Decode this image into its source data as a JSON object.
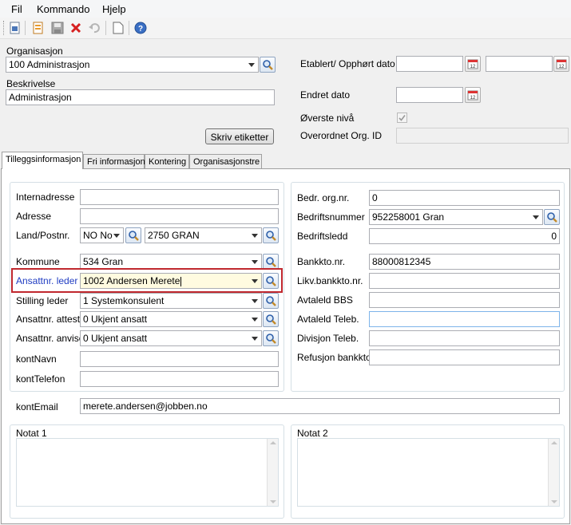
{
  "menu": {
    "file": "Fil",
    "command": "Kommando",
    "help": "Hjelp"
  },
  "header": {
    "organisasjon_label": "Organisasjon",
    "organisasjon_value": "100 Administrasjon",
    "beskrivelse_label": "Beskrivelse",
    "beskrivelse_value": "Administrasjon",
    "etablert_label": "Etablert/ Opphørt dato",
    "endret_label": "Endret dato",
    "overste_label": "Øverste nivå",
    "overste_checked": true,
    "overordnet_label": "Overordnet Org. ID",
    "skriv_etiketter": "Skriv etiketter"
  },
  "tabs": [
    {
      "label": "Tilleggsinformasjon",
      "active": true
    },
    {
      "label": "Fri informasjon",
      "active": false
    },
    {
      "label": "Kontering",
      "active": false
    },
    {
      "label": "Organisasjonstre",
      "active": false
    }
  ],
  "left": {
    "internadresse_label": "Internadresse",
    "internadresse_value": "",
    "adresse_label": "Adresse",
    "adresse_value": "",
    "land_label": "Land/Postnr.",
    "land_value": "NO No",
    "postnr_value": "2750 GRAN",
    "kommune_label": "Kommune",
    "kommune_value": "534 Gran",
    "ansattnr_leder_label": "Ansattnr. leder",
    "ansattnr_leder_value": "1002 Andersen Merete",
    "stilling_label": "Stilling leder",
    "stilling_value": "1 Systemkonsulent",
    "attesta_label": "Ansattnr. attesta",
    "attesta_value": "0 Ukjent ansatt",
    "anvise_label": "Ansattnr. anvise",
    "anvise_value": "0 Ukjent ansatt",
    "kontnavn_label": "kontNavn",
    "kontnavn_value": "",
    "konttelefon_label": "kontTelefon",
    "konttelefon_value": ""
  },
  "right": {
    "bedr_label": "Bedr. org.nr.",
    "bedr_value": "0",
    "bedriftsnummer_label": "Bedriftsnummer",
    "bedriftsnummer_value": "952258001 Gran",
    "bedriftsledd_label": "Bedriftsledd",
    "bedriftsledd_value": "0",
    "bankkto_label": "Bankkto.nr.",
    "bankkto_value": "88000812345",
    "likv_label": "Likv.bankkto.nr.",
    "likv_value": "",
    "avtaleld_bbs_label": "Avtaleld BBS",
    "avtaleld_bbs_value": "",
    "avtaleld_teleb_label": "Avtaleld Teleb.",
    "avtaleld_teleb_value": "",
    "divisjon_label": "Divisjon Teleb.",
    "divisjon_value": "",
    "refusjon_label": "Refusjon bankkto",
    "refusjon_value": ""
  },
  "kontemail_label": "kontEmail",
  "kontemail_value": "merete.andersen@jobben.no",
  "notat1_label": "Notat 1",
  "notat2_label": "Notat 2"
}
